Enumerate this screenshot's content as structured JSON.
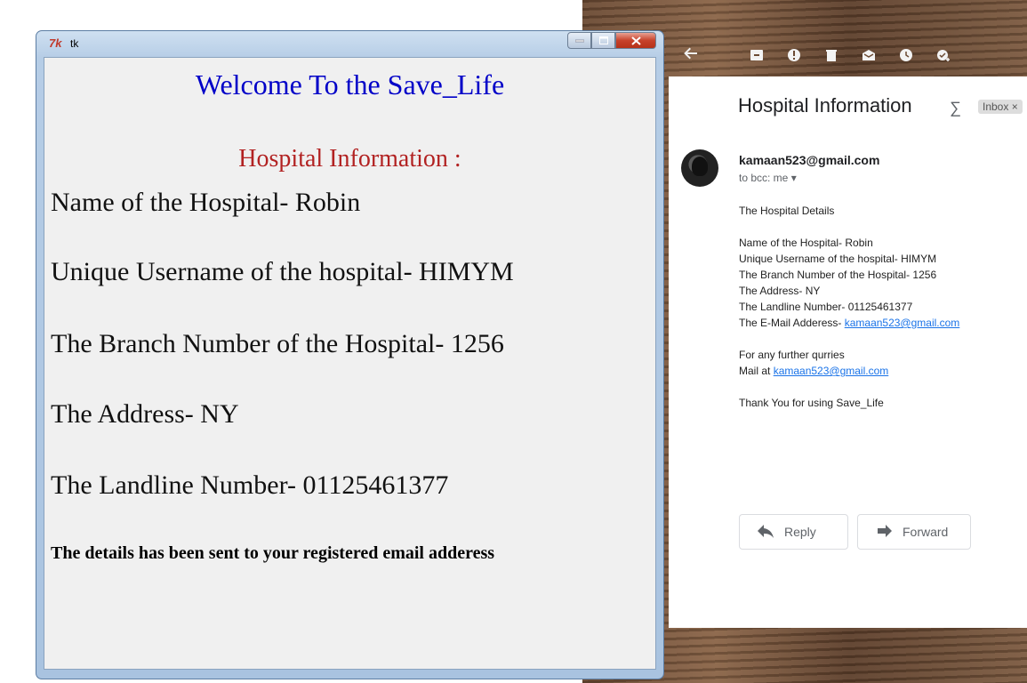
{
  "tk_window": {
    "title": "tk",
    "logo": "7k",
    "welcome": "Welcome To the Save_Life",
    "heading": "Hospital Information :",
    "lines": [
      "Name of the Hospital- Robin",
      "Unique Username of the hospital- HIMYM",
      "The Branch Number of the Hospital- 1256",
      "The Address- NY",
      "The Landline Number- 01125461377"
    ],
    "note": "The details has been sent to your registered email adderess",
    "colors": {
      "welcome": "#0000c8",
      "heading": "#b22222"
    }
  },
  "gmail": {
    "subject": "Hospital Information",
    "subject_icon": "∑",
    "badge": "Inbox ×",
    "sender": "kamaan523@gmail.com",
    "to": "to bcc: me ▾",
    "body": {
      "intro": "The Hospital Details",
      "details": [
        " Name of the Hospital- Robin",
        "Unique Username of the hospital- HIMYM",
        "The Branch Number of the Hospital- 1256",
        "The Address- NY",
        "The Landline Number- 01125461377"
      ],
      "email_prefix": "The E-Mail Adderess- ",
      "email_link": "kamaan523@gmail.com",
      "further": " For any further qurries",
      "mail_prefix": " Mail at ",
      "mail_link": "kamaan523@gmail.com",
      "thanks": "Thank You for using Save_Life"
    },
    "reply_label": "Reply",
    "forward_label": "Forward"
  }
}
